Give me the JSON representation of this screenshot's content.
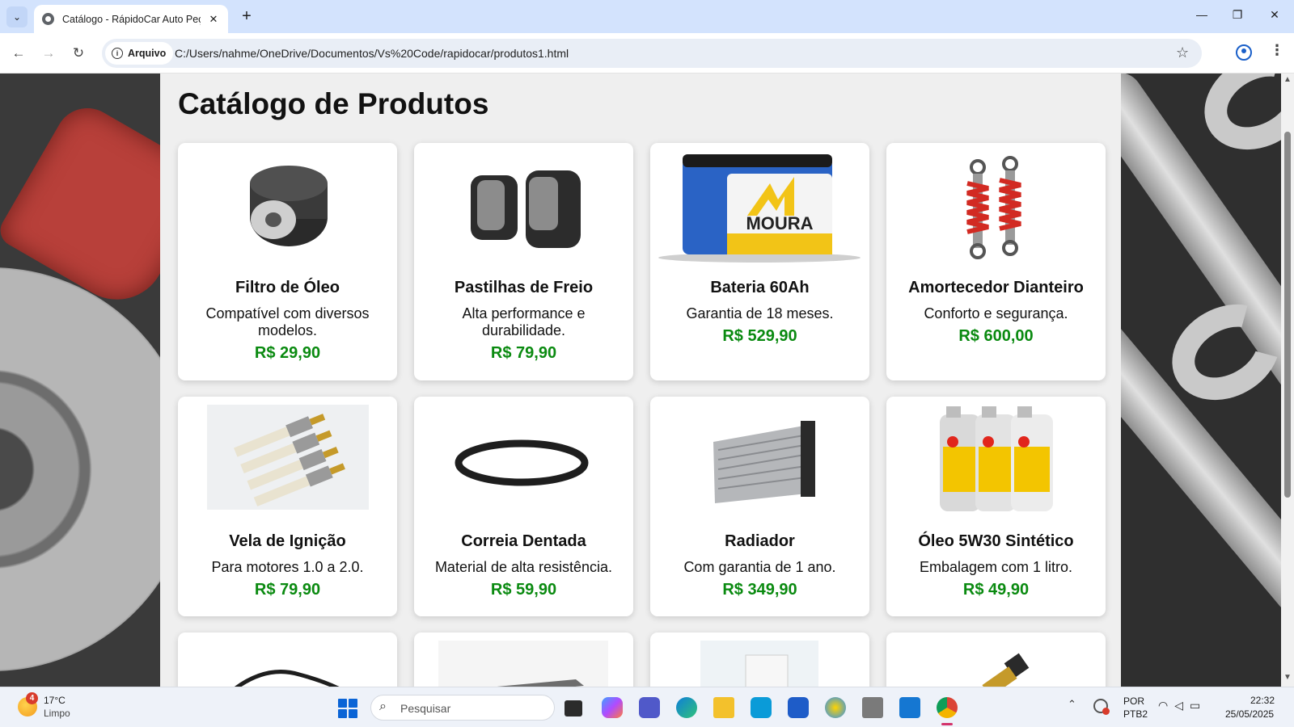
{
  "browser": {
    "tab_title": "Catálogo - RápidoCar Auto Peças",
    "address_chip": "Arquivo",
    "url": "C:/Users/nahme/OneDrive/Documentos/Vs%20Code/rapidocar/produtos1.html"
  },
  "page": {
    "title": "Catálogo de Produtos"
  },
  "products": [
    {
      "name": "Filtro de Óleo",
      "description": "Compatível com diversos modelos.",
      "price": "R$ 29,90",
      "image": "oil-filter"
    },
    {
      "name": "Pastilhas de Freio",
      "description": "Alta performance e durabilidade.",
      "price": "R$ 79,90",
      "image": "brake-pads"
    },
    {
      "name": "Bateria 60Ah",
      "description": "Garantia de 18 meses.",
      "price": "R$ 529,90",
      "image": "battery",
      "brand_mark": "MOURA"
    },
    {
      "name": "Amortecedor Dianteiro",
      "description": "Conforto e segurança.",
      "price": "R$ 600,00",
      "image": "shock-absorber"
    },
    {
      "name": "Vela de Ignição",
      "description": "Para motores 1.0 a 2.0.",
      "price": "R$ 79,90",
      "image": "spark-plugs"
    },
    {
      "name": "Correia Dentada",
      "description": "Material de alta resistência.",
      "price": "R$ 59,90",
      "image": "timing-belt"
    },
    {
      "name": "Radiador",
      "description": "Com garantia de 1 ano.",
      "price": "R$ 349,90",
      "image": "radiator"
    },
    {
      "name": "Óleo 5W30 Sintético",
      "description": "Embalagem com 1 litro.",
      "price": "R$ 49,90",
      "image": "oil-bottles"
    }
  ],
  "taskbar": {
    "weather_badge": "4",
    "temperature": "17°C",
    "condition": "Limpo",
    "search_placeholder": "Pesquisar",
    "lang_line1": "POR",
    "lang_line2": "PTB2",
    "time": "22:32",
    "date": "25/05/2025"
  },
  "colors": {
    "price": "#0a8a10",
    "tabbar": "#d3e3fd",
    "content_bg": "#efefef"
  }
}
